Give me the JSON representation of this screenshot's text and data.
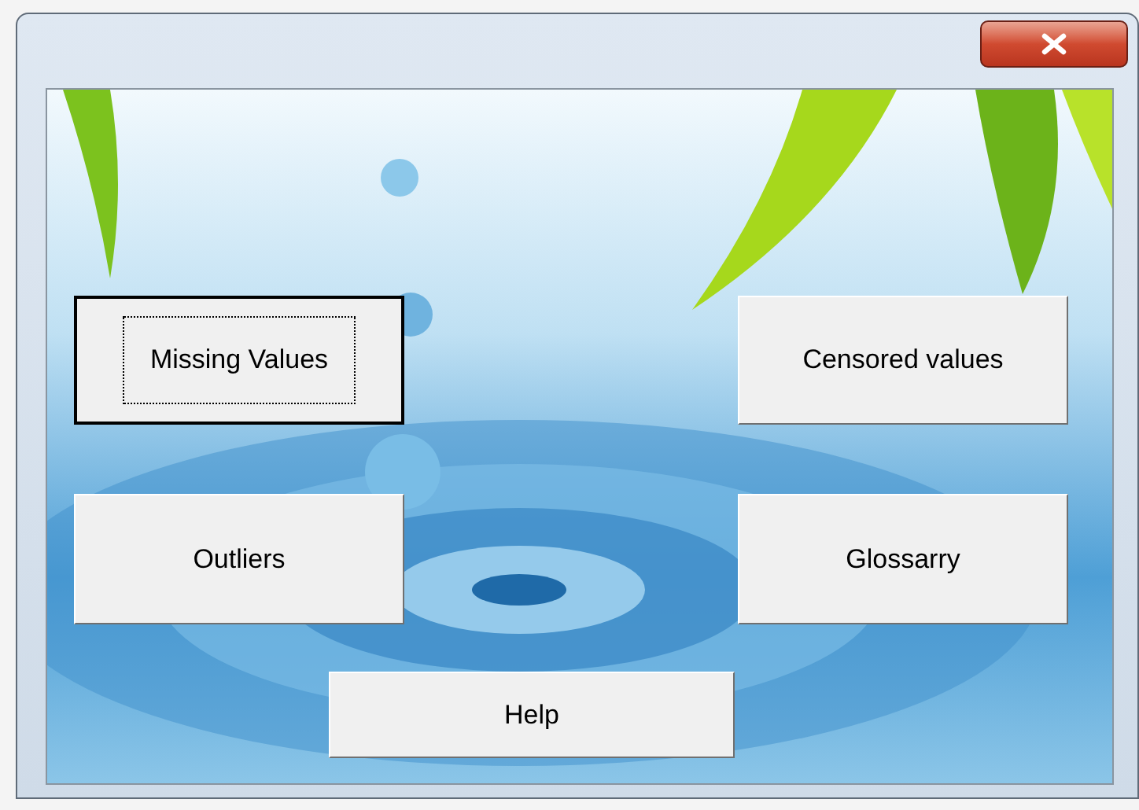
{
  "buttons": [
    {
      "label": "Missing Values",
      "focused": true
    },
    {
      "label": "Censored values",
      "focused": false
    },
    {
      "label": "Outliers",
      "focused": false
    },
    {
      "label": "Glossarry",
      "focused": false
    },
    {
      "label": "Help",
      "focused": false
    }
  ]
}
